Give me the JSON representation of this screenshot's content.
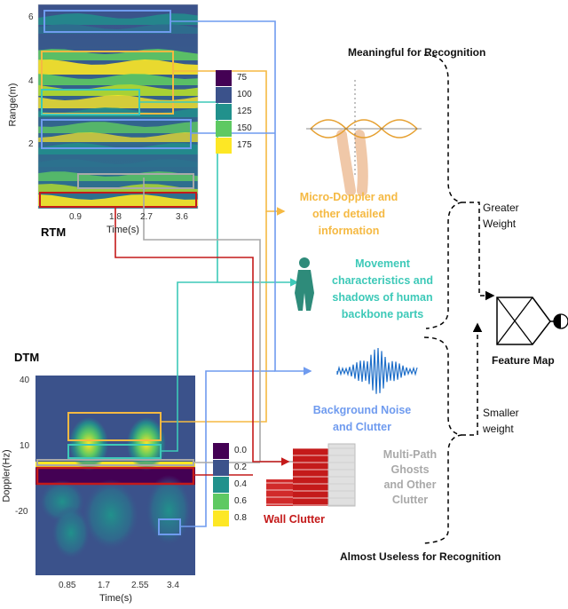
{
  "rtm": {
    "label": "RTM",
    "ylabel": "Range(m)",
    "xlabel": "Time(s)",
    "yticks": [
      "6",
      "4",
      "2"
    ],
    "xticks": [
      "0.9",
      "1.8",
      "2.7",
      "3.6"
    ],
    "legend": [
      {
        "value": "75",
        "color": "#440154"
      },
      {
        "value": "100",
        "color": "#3b528b"
      },
      {
        "value": "125",
        "color": "#21918c"
      },
      {
        "value": "150",
        "color": "#5ec962"
      },
      {
        "value": "175",
        "color": "#fde725"
      }
    ]
  },
  "dtm": {
    "label": "DTM",
    "ylabel": "Doppler(Hz)",
    "xlabel": "Time(s)",
    "yticks": [
      "40",
      "10",
      "-20"
    ],
    "xticks": [
      "0.85",
      "1.7",
      "2.55",
      "3.4"
    ],
    "legend": [
      {
        "value": "0.0",
        "color": "#440154"
      },
      {
        "value": "0.2",
        "color": "#3b528b"
      },
      {
        "value": "0.4",
        "color": "#21918c"
      },
      {
        "value": "0.6",
        "color": "#5ec962"
      },
      {
        "value": "0.8",
        "color": "#fde725"
      }
    ]
  },
  "categories": {
    "micro_doppler": {
      "lines": [
        "Micro-Doppler and",
        "other detailed",
        "information"
      ],
      "color": "#f5b942"
    },
    "movement": {
      "lines": [
        "Movement",
        "characteristics and",
        "shadows of human",
        "backbone parts"
      ],
      "color": "#3dc9b8"
    },
    "background": {
      "lines": [
        "Background Noise",
        "and Clutter"
      ],
      "color": "#6f9bef"
    },
    "multipath": {
      "lines": [
        "Multi-Path",
        "Ghosts",
        "and Other",
        "Clutter"
      ],
      "color": "#a9a9a9"
    },
    "wall": {
      "lines": [
        "Wall Clutter"
      ],
      "color": "#c41a1a"
    }
  },
  "headers": {
    "meaningful": "Meaningful for Recognition",
    "useless": "Almost Useless for Recognition"
  },
  "weights": {
    "greater": [
      "Greater",
      "Weight"
    ],
    "smaller": [
      "Smaller",
      "weight"
    ]
  },
  "feature_map": "Feature Map"
}
